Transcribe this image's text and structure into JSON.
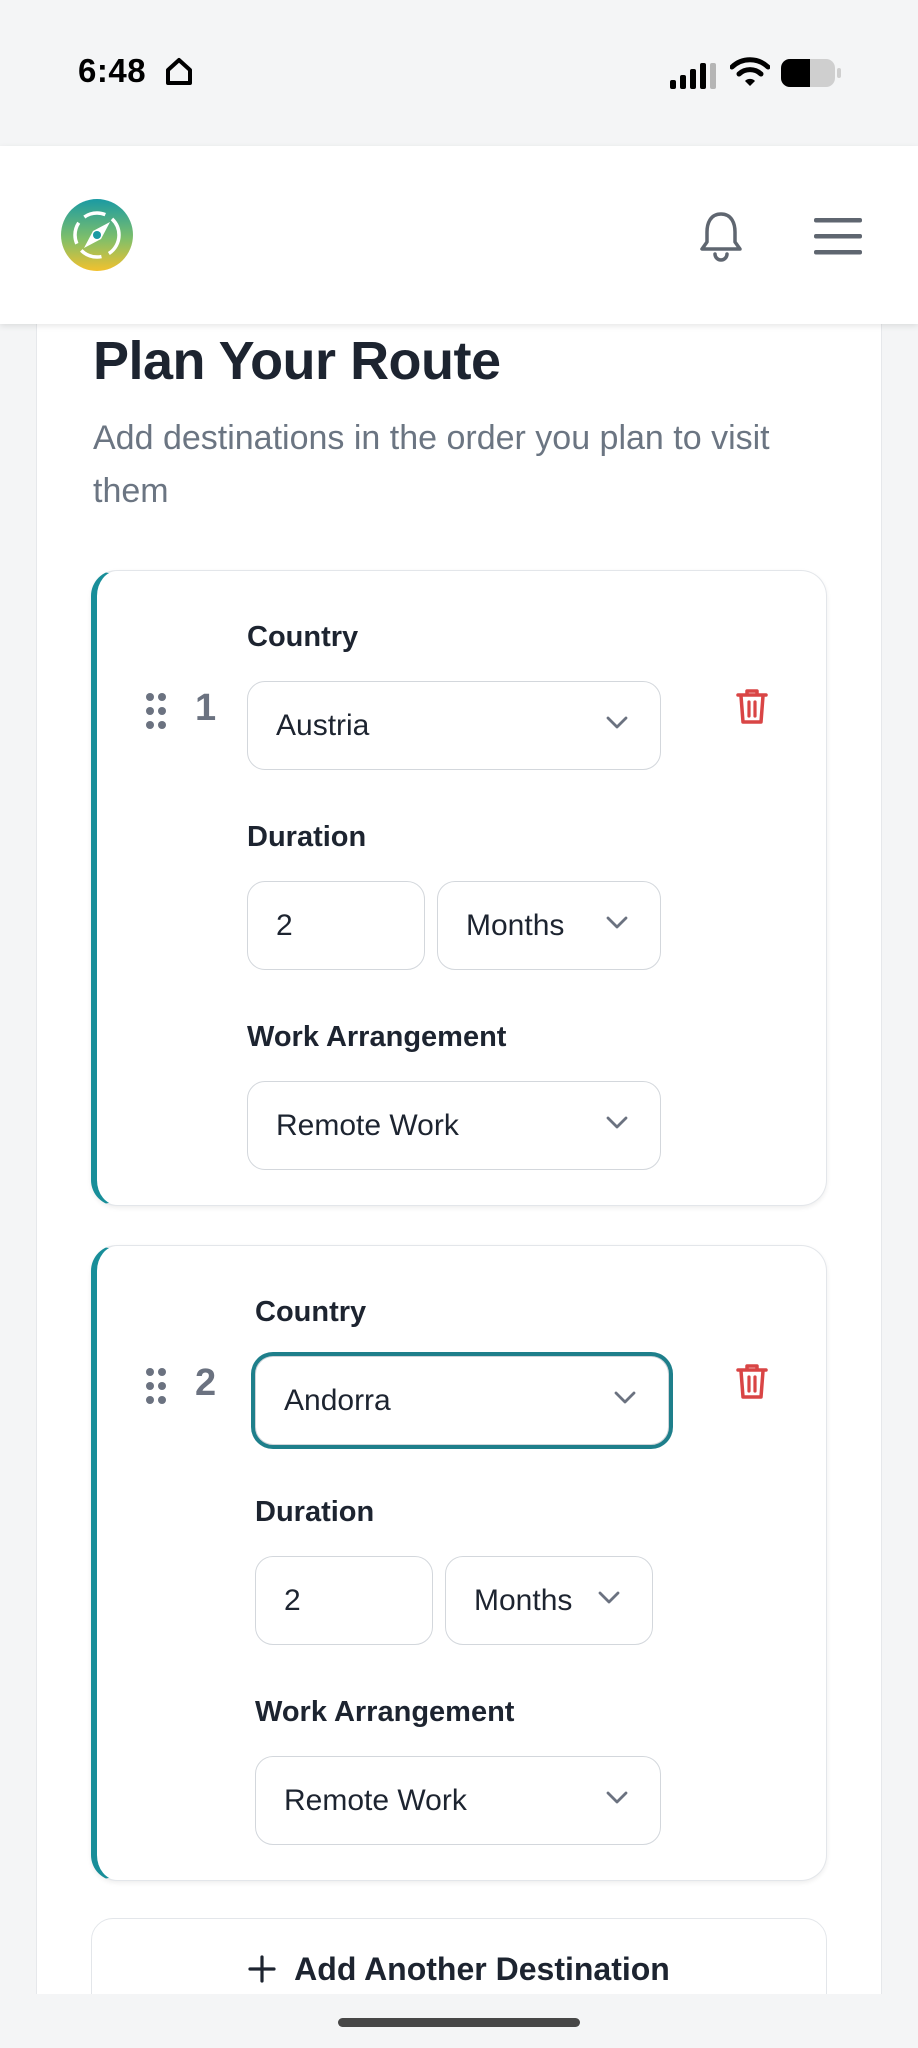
{
  "status_bar": {
    "time": "6:48",
    "icons": [
      "home-icon",
      "signal-icon",
      "wifi-icon",
      "battery-icon"
    ]
  },
  "header": {
    "logo": "compass-logo",
    "icons": [
      "bell-icon",
      "hamburger-menu-icon"
    ]
  },
  "page": {
    "title": "Plan Your Route",
    "subtitle": "Add destinations in the order you plan to visit them"
  },
  "destinations": [
    {
      "number": "1",
      "country_label": "Country",
      "country": "Austria",
      "duration_label": "Duration",
      "duration_value": "2",
      "duration_unit": "Months",
      "work_label": "Work Arrangement",
      "work": "Remote Work"
    },
    {
      "number": "2",
      "country_label": "Country",
      "country": "Andorra",
      "duration_label": "Duration",
      "duration_value": "2",
      "duration_unit": "Months",
      "work_label": "Work Arrangement",
      "work": "Remote Work"
    }
  ],
  "add_button_label": "Add Another Destination",
  "colors": {
    "accent": "#188e99",
    "focus_ring": "#1e7f8b",
    "delete": "#d94545",
    "text_primary": "#1d2430",
    "text_secondary": "#6b7582"
  }
}
